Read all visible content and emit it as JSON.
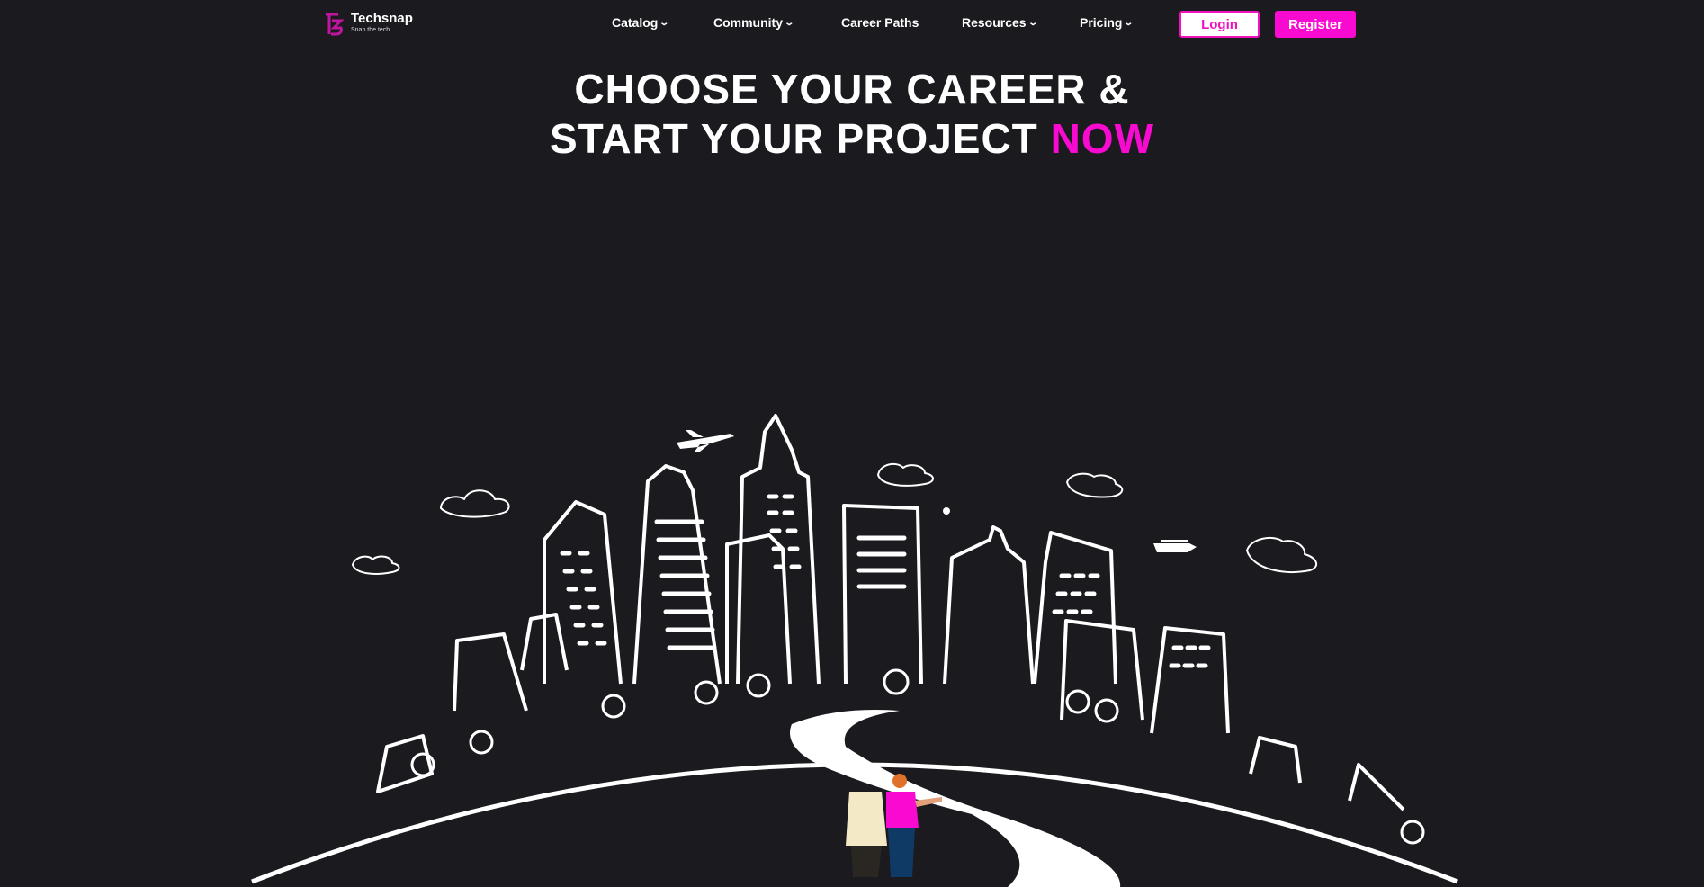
{
  "brand": {
    "name": "Techsnap",
    "tagline": "Snap the tech",
    "accent": "#f90ad0"
  },
  "nav": {
    "items": [
      {
        "label": "Catalog",
        "dropdown": true
      },
      {
        "label": "Community",
        "dropdown": true
      },
      {
        "label": "Career Paths",
        "dropdown": false
      },
      {
        "label": "Resources",
        "dropdown": true
      },
      {
        "label": "Pricing",
        "dropdown": true
      }
    ],
    "login": "Login",
    "register": "Register"
  },
  "hero": {
    "line1": "CHOOSE YOUR CAREER &",
    "line2": "START YOUR PROJECT",
    "highlight": "NOW"
  }
}
